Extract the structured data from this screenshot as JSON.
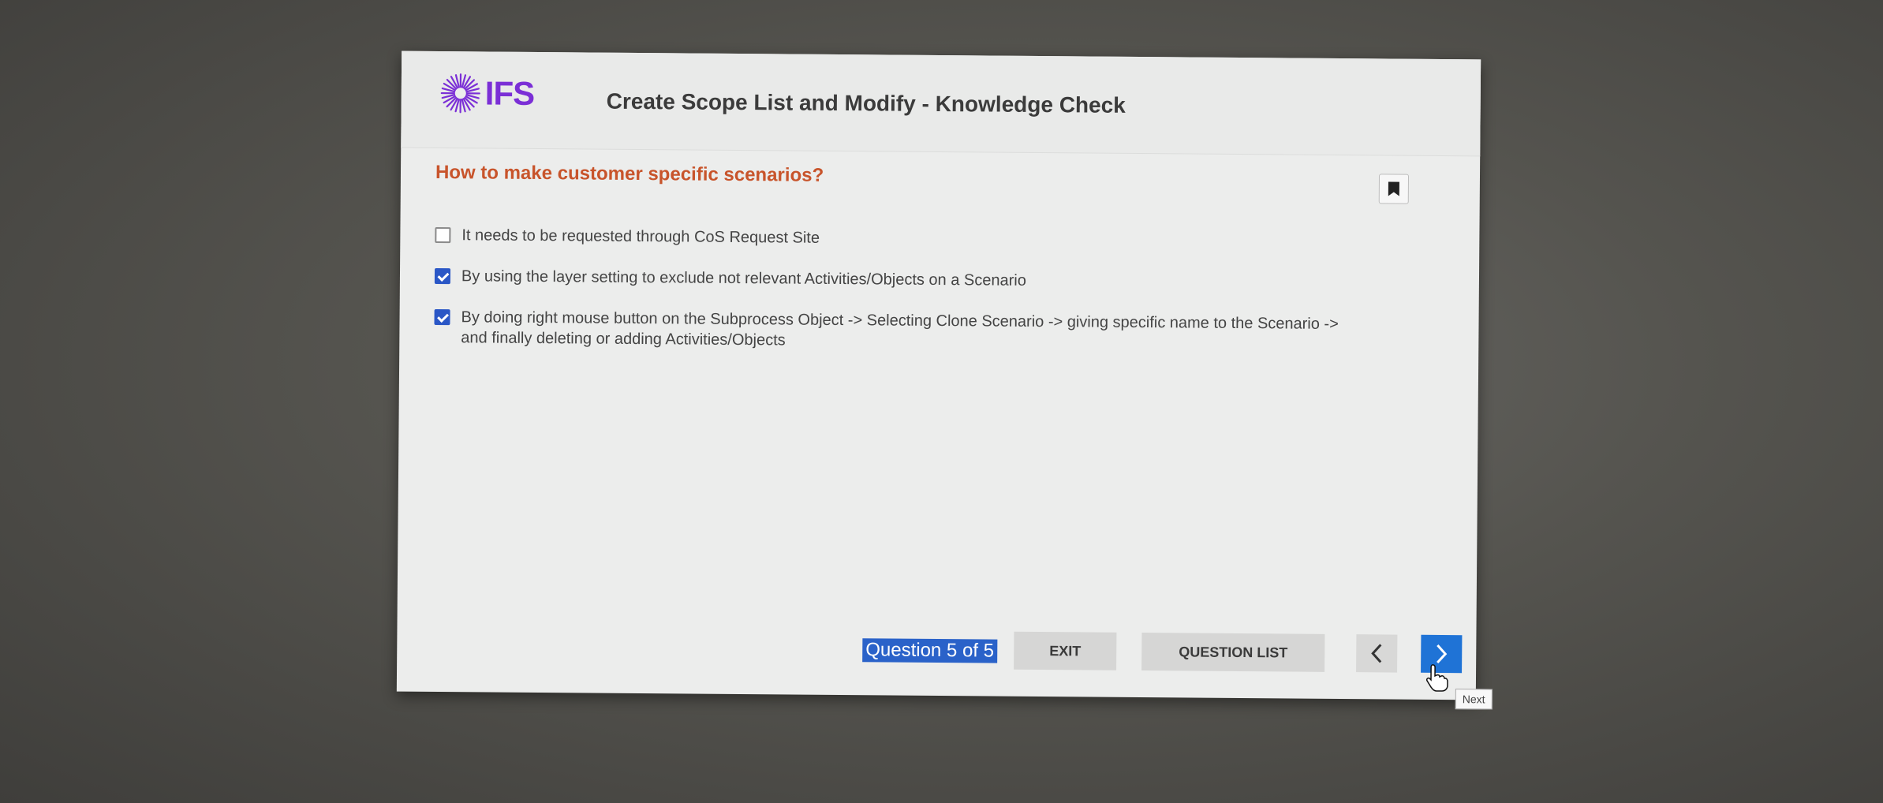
{
  "header": {
    "logo_text": "IFS",
    "title": "Create Scope List and Modify - Knowledge Check"
  },
  "question": {
    "text": "How to make customer specific scenarios?",
    "options": [
      {
        "label": "It needs to be requested through CoS Request Site",
        "checked": false
      },
      {
        "label": "By using the layer setting to exclude not relevant Activities/Objects on a Scenario",
        "checked": true
      },
      {
        "label": "By doing right mouse button on the Subprocess Object -> Selecting Clone Scenario -> giving specific name to the Scenario -> and finally deleting or adding Activities/Objects",
        "checked": true
      }
    ]
  },
  "footer": {
    "counter": "Question 5 of 5",
    "exit_label": "EXIT",
    "question_list_label": "QUESTION LIST",
    "next_tooltip": "Next"
  },
  "icons": {
    "logo": "ifs-burst-logo",
    "bookmark": "bookmark-icon",
    "prev": "chevron-left-icon",
    "next": "chevron-right-icon",
    "cursor": "hand-pointer-icon"
  },
  "colors": {
    "brand": "#7b2fd6",
    "question": "#c8542b",
    "accent": "#1f73d6",
    "checkbox": "#2a57c6"
  }
}
